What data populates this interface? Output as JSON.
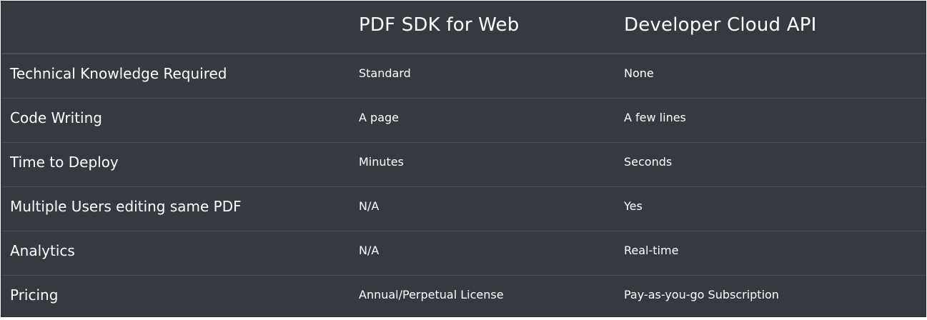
{
  "header": {
    "col1": "PDF SDK for Web",
    "col2": "Developer Cloud API"
  },
  "rows": [
    {
      "label": "Technical Knowledge Required",
      "col1": "Standard",
      "col2": "None"
    },
    {
      "label": "Code Writing",
      "col1": "A page",
      "col2": "A few lines"
    },
    {
      "label": "Time to Deploy",
      "col1": "Minutes",
      "col2": "Seconds"
    },
    {
      "label": "Multiple Users editing same PDF",
      "col1": "N/A",
      "col2": "Yes"
    },
    {
      "label": "Analytics",
      "col1": "N/A",
      "col2": "Real-time"
    },
    {
      "label": "Pricing",
      "col1": "Annual/Perpetual License",
      "col2": "Pay-as-you-go Subscription"
    }
  ],
  "colors": {
    "background": "#353a40",
    "divider": "#4a4f56",
    "text": "#ffffff"
  }
}
